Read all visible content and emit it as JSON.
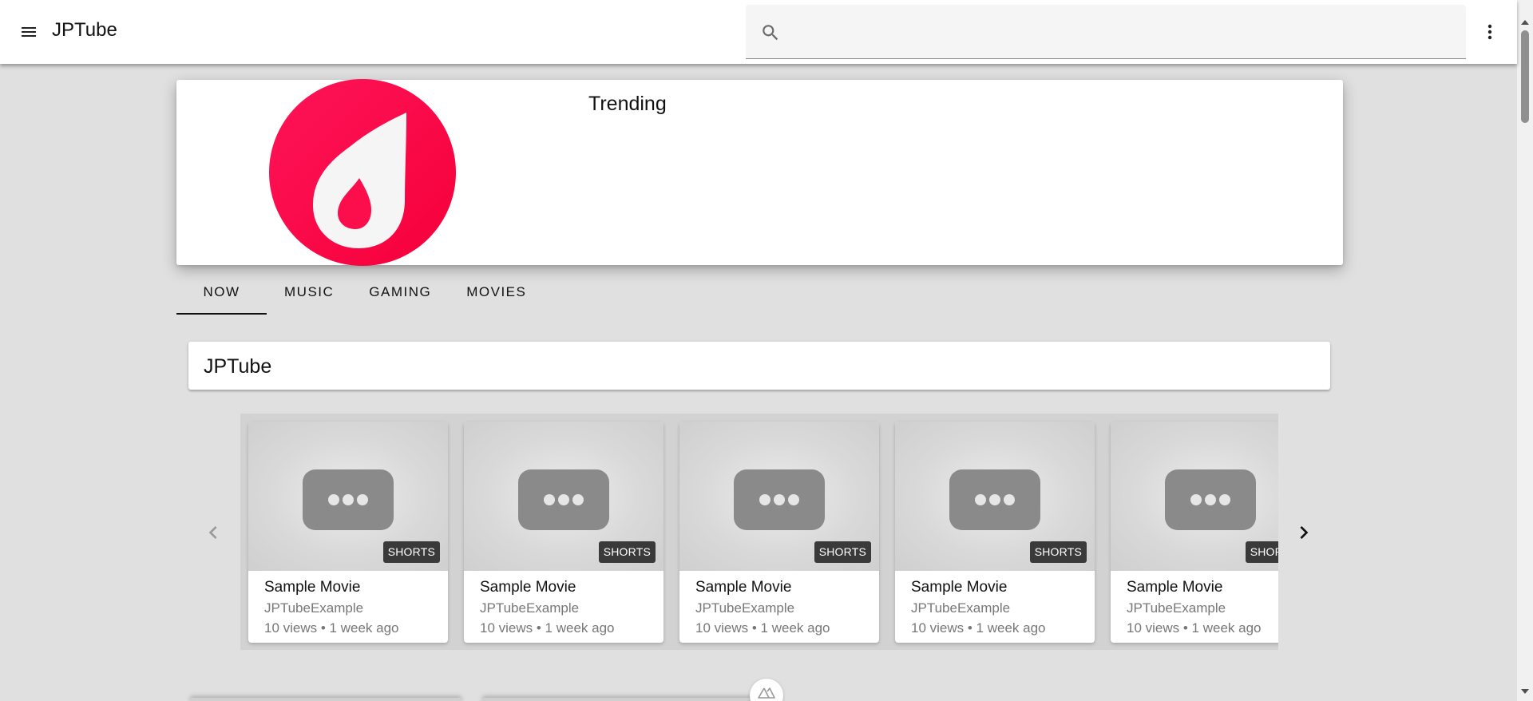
{
  "appbar": {
    "title": "JPTube",
    "search_placeholder": "",
    "icons": {
      "menu": "menu-icon",
      "search": "search-icon",
      "more": "more-vert-icon"
    }
  },
  "header": {
    "title": "Trending",
    "logo": "trending-fire-logo",
    "logo_color": "#fe0a4a"
  },
  "tabs": [
    {
      "label": "NOW",
      "active": true
    },
    {
      "label": "MUSIC",
      "active": false
    },
    {
      "label": "GAMING",
      "active": false
    },
    {
      "label": "MOVIES",
      "active": false
    }
  ],
  "section": {
    "title": "JPTube"
  },
  "carousel": {
    "prev_icon": "chevron-left-icon",
    "next_icon": "chevron-right-icon",
    "items": [
      {
        "title": "Sample Movie",
        "channel": "JPTubeExample",
        "meta": "10 views • 1 week ago",
        "badge": "SHORTS"
      },
      {
        "title": "Sample Movie",
        "channel": "JPTubeExample",
        "meta": "10 views • 1 week ago",
        "badge": "SHORTS"
      },
      {
        "title": "Sample Movie",
        "channel": "JPTubeExample",
        "meta": "10 views • 1 week ago",
        "badge": "SHORTS"
      },
      {
        "title": "Sample Movie",
        "channel": "JPTubeExample",
        "meta": "10 views • 1 week ago",
        "badge": "SHORTS"
      },
      {
        "title": "Sample Movie",
        "channel": "JPTubeExample",
        "meta": "10 views • 1 week ago",
        "badge": "SHORTS"
      }
    ]
  },
  "colors": {
    "brand": "#fe0a4a",
    "page_bg": "#e0e0e0",
    "badge_bg": "#3a3a3a"
  }
}
